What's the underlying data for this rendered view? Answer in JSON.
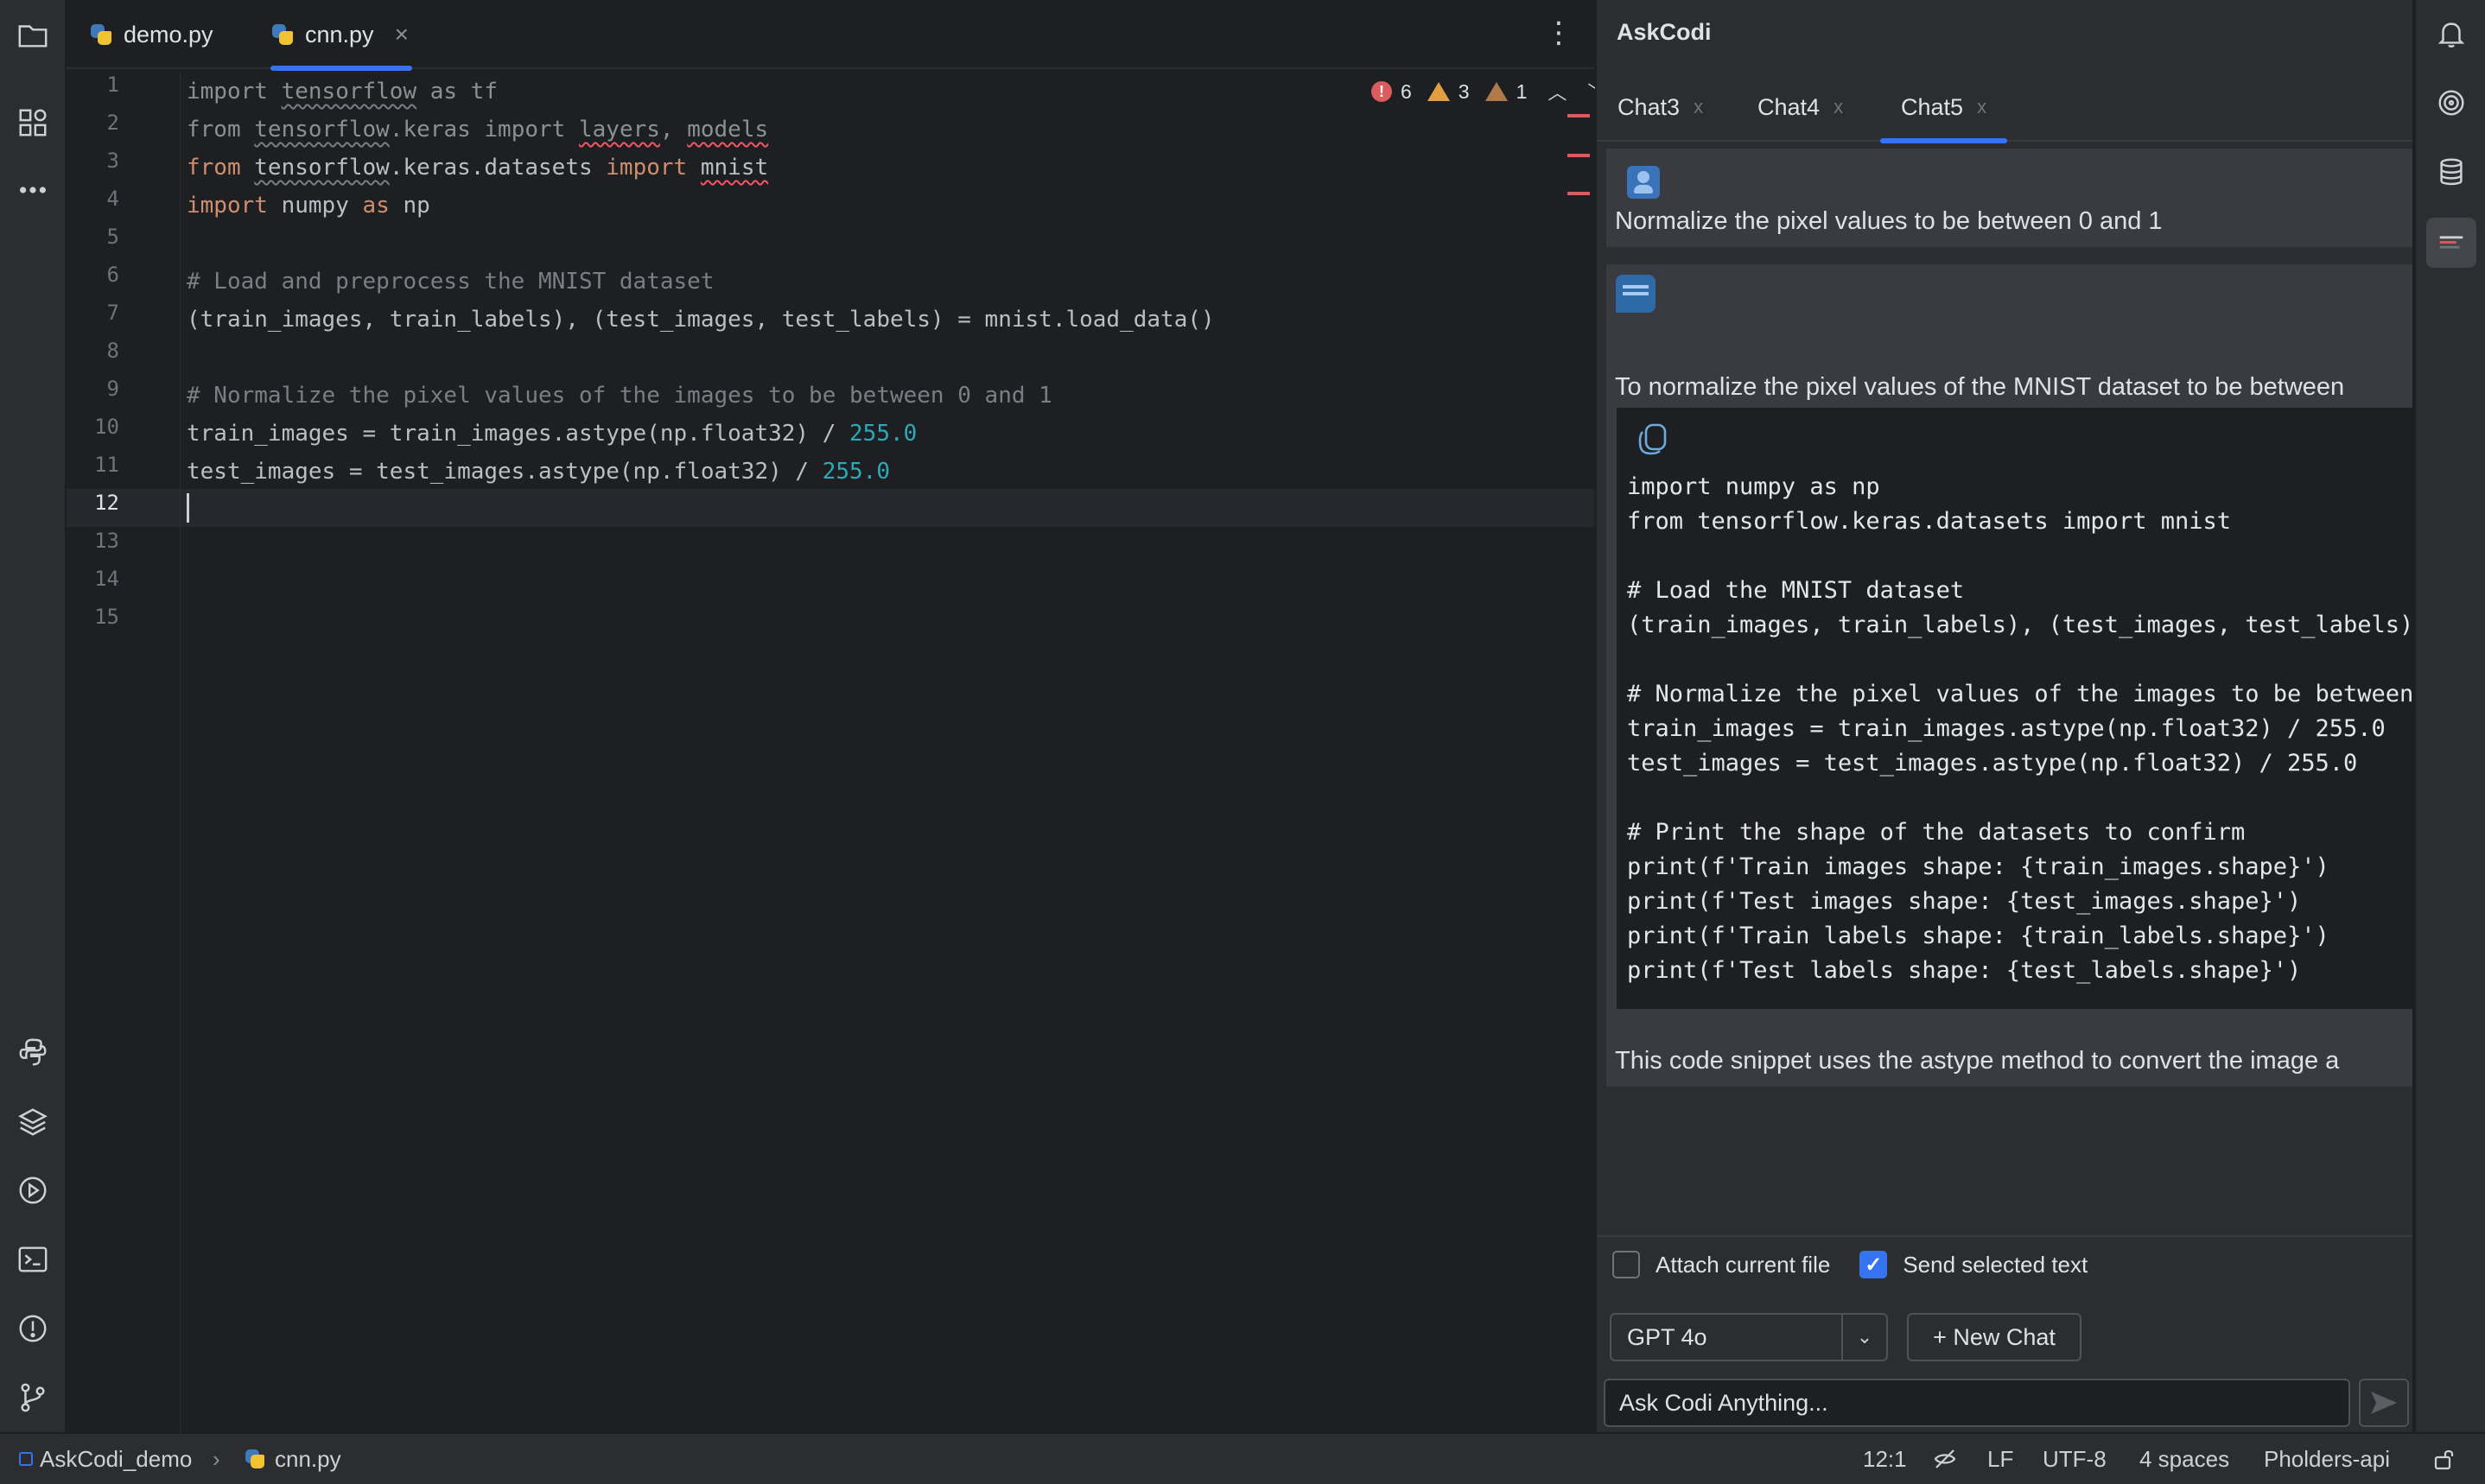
{
  "editor": {
    "tabs": [
      {
        "label": "demo.py",
        "active": false
      },
      {
        "label": "cnn.py",
        "active": true
      }
    ],
    "tab_close": "×",
    "line_numbers": [
      "1",
      "2",
      "3",
      "4",
      "5",
      "6",
      "7",
      "8",
      "9",
      "10",
      "11",
      "12",
      "13",
      "14",
      "15"
    ],
    "current_line": 12,
    "inspections": {
      "errors": "6",
      "warnings": "3",
      "weak_warnings": "1"
    },
    "code": {
      "l1": {
        "a": "import ",
        "b": "tensorflow",
        "c": " as tf"
      },
      "l2": {
        "a": "from ",
        "b": "tensorflow",
        "c": ".keras ",
        "d": "import ",
        "e": "layers",
        "f": ", ",
        "g": "models"
      },
      "l3": {
        "a": "from ",
        "b": "tensorflow",
        "c": ".keras.datasets ",
        "d": "import ",
        "e": "mnist"
      },
      "l4": {
        "a": "import ",
        "b": "numpy ",
        "c": "as ",
        "d": "np"
      },
      "l6": "# Load and preprocess the MNIST dataset",
      "l7": "(train_images, train_labels), (test_images, test_labels) = mnist.load_data()",
      "l9": "# Normalize the pixel values of the images to be between 0 and 1",
      "l10": {
        "a": "train_images = train_images.astype(np.float32) / ",
        "b": "255.0"
      },
      "l11": {
        "a": "test_images = test_images.astype(np.float32) / ",
        "b": "255.0"
      }
    }
  },
  "panel": {
    "title": "AskCodi",
    "chat_tabs": [
      {
        "label": "Chat3",
        "active": false
      },
      {
        "label": "Chat4",
        "active": false
      },
      {
        "label": "Chat5",
        "active": true
      }
    ],
    "chat_tab_close": "x",
    "user_message": "Normalize the pixel values to be between 0 and 1",
    "bot_intro": "To normalize the pixel values of the MNIST dataset to be between",
    "code_lines": [
      "import numpy as np",
      "from tensorflow.keras.datasets import mnist",
      "",
      "# Load the MNIST dataset",
      "(train_images, train_labels), (test_images, test_labels)",
      "",
      "# Normalize the pixel values of the images to be between",
      "train_images = train_images.astype(np.float32) / 255.0",
      "test_images = test_images.astype(np.float32) / 255.0",
      "",
      "# Print the shape of the datasets to confirm",
      "print(f'Train images shape: {train_images.shape}')",
      "print(f'Test images shape: {test_images.shape}')",
      "print(f'Train labels shape: {train_labels.shape}')",
      "print(f'Test labels shape: {test_labels.shape}')"
    ],
    "bot_outro": "This code snippet uses the astype method to convert the image a",
    "attach_file_label": "Attach current file",
    "attach_file_checked": false,
    "send_selected_label": "Send selected text",
    "send_selected_checked": true,
    "model": "GPT 4o",
    "new_chat_label": "+ New Chat",
    "input_placeholder": "Ask Codi Anything..."
  },
  "status_bar": {
    "project": "AskCodi_demo",
    "file": "cnn.py",
    "position": "12:1",
    "line_ending": "LF",
    "encoding": "UTF-8",
    "indent": "4 spaces",
    "interpreter": "Pholders-api"
  },
  "colors": {
    "accent": "#3574f0",
    "keyword": "#cf8e6d",
    "number": "#2aacb8",
    "error": "#db5c5c"
  }
}
